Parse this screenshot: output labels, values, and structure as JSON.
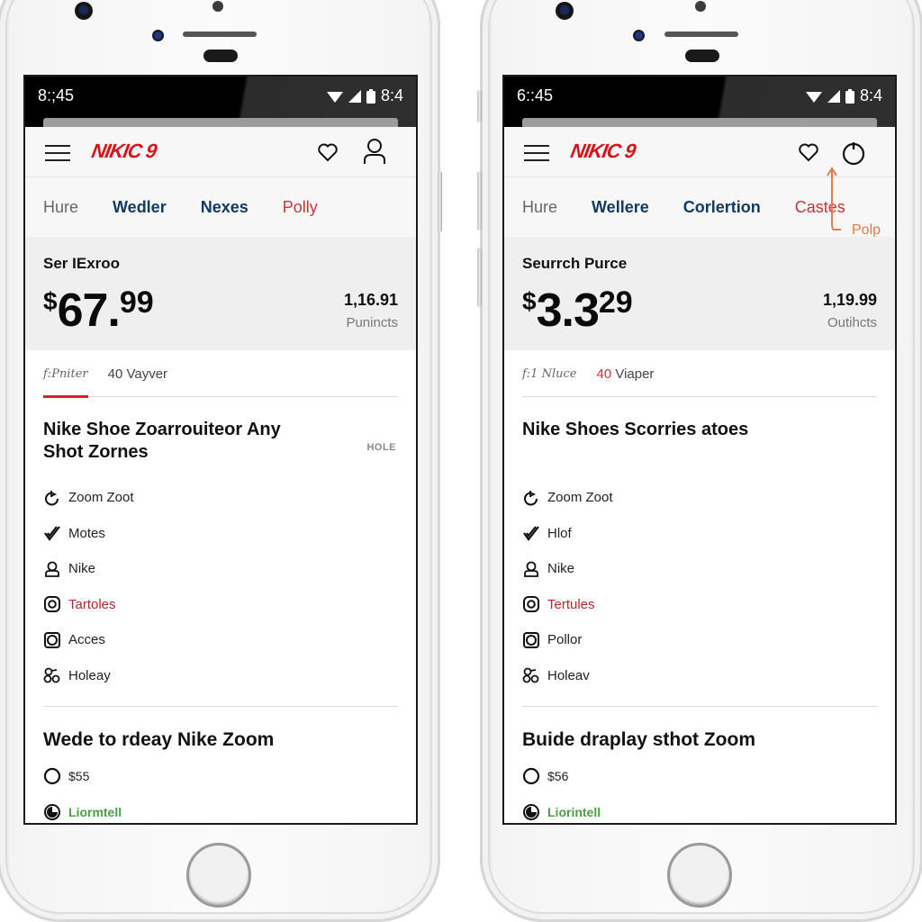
{
  "phones": [
    {
      "status": {
        "time_left": "8:;45",
        "time_right": "8:4"
      },
      "header": {
        "logo": "NIKIC 9",
        "right_icon": "user-icon"
      },
      "tabs": [
        "Hure",
        "Wedler",
        "Nexes",
        "Polly"
      ],
      "price_panel": {
        "label": "Ser IExroo",
        "currency": "$",
        "price_main": "67.",
        "price_sup": "99",
        "stat_value": "1,16.91",
        "stat_label": "Punincts"
      },
      "subtabs": {
        "italic": "f:Pniter",
        "count": "40",
        "count_label": "Vayver"
      },
      "section1": {
        "title": "Nike Shoe Zoarrouiteor Any Shot Zornes",
        "tag": "HOLE",
        "items": [
          {
            "icon": "refresh-icon",
            "label": "Zoom Zoot"
          },
          {
            "icon": "check-icon",
            "label": "Motes"
          },
          {
            "icon": "person-icon",
            "label": "Nike"
          },
          {
            "icon": "target-icon",
            "label": "Tartoles",
            "accent": true
          },
          {
            "icon": "square-ring-icon",
            "label": "Acces"
          },
          {
            "icon": "knot-icon",
            "label": "Holeay"
          }
        ]
      },
      "section2": {
        "title": "Wede to rdeay Nike Zoom",
        "items": [
          {
            "icon": "circle-icon",
            "label": "$55"
          },
          {
            "icon": "timer-icon",
            "label": "Liormtell",
            "green": true
          }
        ]
      }
    },
    {
      "status": {
        "time_left": "6::45",
        "time_right": "8:4"
      },
      "header": {
        "logo": "NIKIC 9",
        "right_icon": "power-icon"
      },
      "tabs": [
        "Hure",
        "Wellere",
        "Corlertion",
        "Castes"
      ],
      "annotation": "Polp",
      "price_panel": {
        "label": "Seurrch Purce",
        "currency": "$",
        "price_main": "3.3",
        "price_sup": "29",
        "stat_value": "1,19.99",
        "stat_label": "Outihcts"
      },
      "subtabs": {
        "italic": "f:1 Nluce",
        "count": "40",
        "count_label": "Viaper"
      },
      "section1": {
        "title": "Nike Shoes Scorries atoes",
        "items": [
          {
            "icon": "refresh-icon",
            "label": "Zoom Zoot"
          },
          {
            "icon": "check-icon",
            "label": "Hlof"
          },
          {
            "icon": "person-icon",
            "label": "Nike"
          },
          {
            "icon": "target-icon",
            "label": "Tertules",
            "accent": true
          },
          {
            "icon": "square-ring-icon",
            "label": "Pollor"
          },
          {
            "icon": "knot-icon",
            "label": "Holeav"
          }
        ]
      },
      "section2": {
        "title": "Buide draplay sthot Zoom",
        "items": [
          {
            "icon": "circle-icon",
            "label": "$56"
          },
          {
            "icon": "timer-icon",
            "label": "Liorintell",
            "green": true
          }
        ]
      }
    }
  ],
  "colors": {
    "brand_red": "#d3141b",
    "tab_navy": "#143a63",
    "accent_red": "#c9343c",
    "green": "#4aa046",
    "annotation_orange": "#e27a4a"
  }
}
